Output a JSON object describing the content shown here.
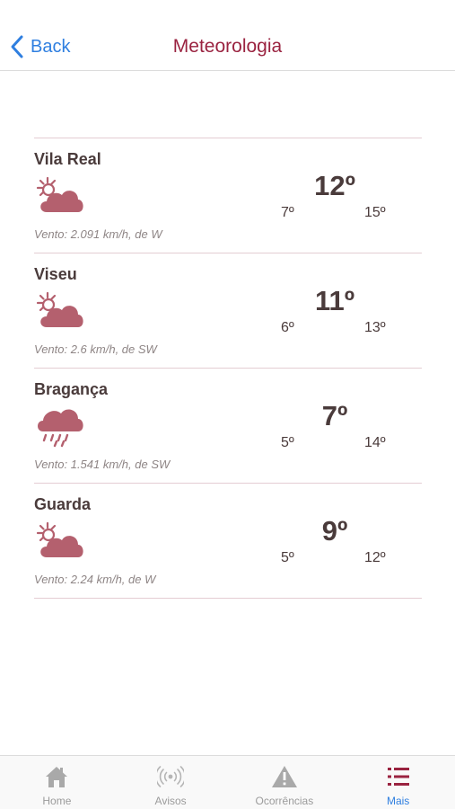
{
  "nav": {
    "back_label": "Back",
    "title": "Meteorologia"
  },
  "colors": {
    "accent": "#9a2340",
    "icon": "#b4606e",
    "link": "#2f7fe0"
  },
  "forecasts": [
    {
      "city": "Vila Real",
      "icon": "partly-cloudy-icon",
      "wind": "Vento: 2.091 km/h, de W",
      "temp": "12º",
      "min": "7º",
      "max": "15º"
    },
    {
      "city": "Viseu",
      "icon": "partly-cloudy-icon",
      "wind": "Vento: 2.6 km/h, de SW",
      "temp": "11º",
      "min": "6º",
      "max": "13º"
    },
    {
      "city": "Bragança",
      "icon": "rain-cloud-icon",
      "wind": "Vento: 1.541 km/h, de SW",
      "temp": "7º",
      "min": "5º",
      "max": "14º"
    },
    {
      "city": "Guarda",
      "icon": "partly-cloudy-icon",
      "wind": "Vento: 2.24 km/h, de W",
      "temp": "9º",
      "min": "5º",
      "max": "12º"
    }
  ],
  "tabbar": {
    "items": [
      {
        "label": "Home",
        "icon": "home-icon"
      },
      {
        "label": "Avisos",
        "icon": "broadcast-icon"
      },
      {
        "label": "Ocorrências",
        "icon": "warning-icon"
      },
      {
        "label": "Mais",
        "icon": "list-icon",
        "active": true
      }
    ]
  }
}
